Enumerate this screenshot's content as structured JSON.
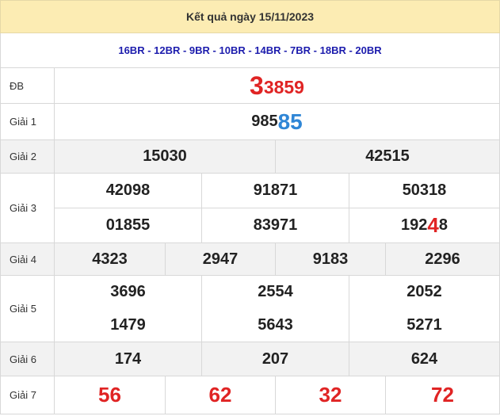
{
  "header": {
    "title": "Kết quả ngày 15/11/2023"
  },
  "codes": {
    "text": "16BR - 12BR - 9BR - 10BR - 14BR - 7BR - 18BR - 20BR"
  },
  "labels": {
    "db": "ĐB",
    "g1": "Giải 1",
    "g2": "Giải 2",
    "g3": "Giải 3",
    "g4": "Giải 4",
    "g5": "Giải 5",
    "g6": "Giải 6",
    "g7": "Giải 7"
  },
  "special": {
    "lead": "3",
    "tail": "3859"
  },
  "prize1": {
    "lead": "985",
    "tail": "85"
  },
  "prize2": [
    "15030",
    "42515"
  ],
  "prize3": {
    "row1": [
      "42098",
      "91871",
      "50318"
    ],
    "row2_a": "01855",
    "row2_b": "83971",
    "row2_c_lead": "192",
    "row2_c_red": "4",
    "row2_c_tail": "8"
  },
  "prize4": [
    "4323",
    "2947",
    "9183",
    "2296"
  ],
  "prize5": {
    "row1": [
      "3696",
      "2554",
      "2052"
    ],
    "row2": [
      "1479",
      "5643",
      "5271"
    ]
  },
  "prize6": [
    "174",
    "207",
    "624"
  ],
  "prize7": [
    "56",
    "62",
    "32",
    "72"
  ],
  "colors": {
    "header_bg": "#fcecb3",
    "codes_text": "#1c1cad",
    "red": "#e02424",
    "blue": "#2f86d6",
    "shade_row": "#f2f2f2"
  }
}
